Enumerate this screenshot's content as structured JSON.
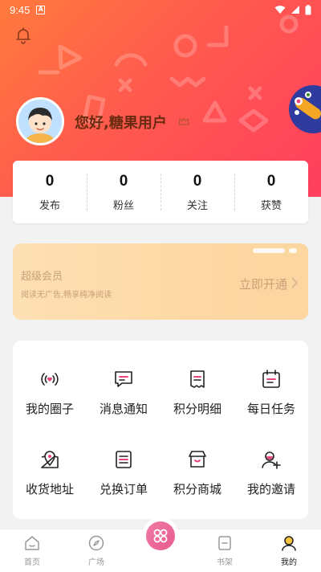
{
  "status_bar": {
    "time": "9:45",
    "a_label": "A"
  },
  "profile": {
    "greeting": "您好,糖果用户"
  },
  "stats": [
    {
      "value": "0",
      "label": "发布"
    },
    {
      "value": "0",
      "label": "粉丝"
    },
    {
      "value": "0",
      "label": "关注"
    },
    {
      "value": "0",
      "label": "获赞"
    }
  ],
  "vip": {
    "title": "超级会员",
    "subtitle": "阅读无广告,畅享纯净阅读",
    "cta": "立即开通"
  },
  "menu": [
    {
      "label": "我的圈子",
      "icon": "circle-broadcast-icon"
    },
    {
      "label": "消息通知",
      "icon": "message-icon"
    },
    {
      "label": "积分明细",
      "icon": "receipt-icon"
    },
    {
      "label": "每日任务",
      "icon": "calendar-icon"
    },
    {
      "label": "收货地址",
      "icon": "map-pin-icon"
    },
    {
      "label": "兑换订单",
      "icon": "order-list-icon"
    },
    {
      "label": "积分商城",
      "icon": "store-icon"
    },
    {
      "label": "我的邀请",
      "icon": "add-user-icon"
    }
  ],
  "tabs": [
    {
      "label": "首页",
      "icon": "home-icon"
    },
    {
      "label": "广场",
      "icon": "compass-icon"
    },
    {
      "label": "",
      "icon": "center-grid-icon"
    },
    {
      "label": "书架",
      "icon": "bookshelf-icon"
    },
    {
      "label": "我的",
      "icon": "user-icon"
    }
  ],
  "colors": {
    "accent": "#ff4f57",
    "menu_icon_accent": "#e8467a",
    "vip_text": "#c9a079"
  }
}
